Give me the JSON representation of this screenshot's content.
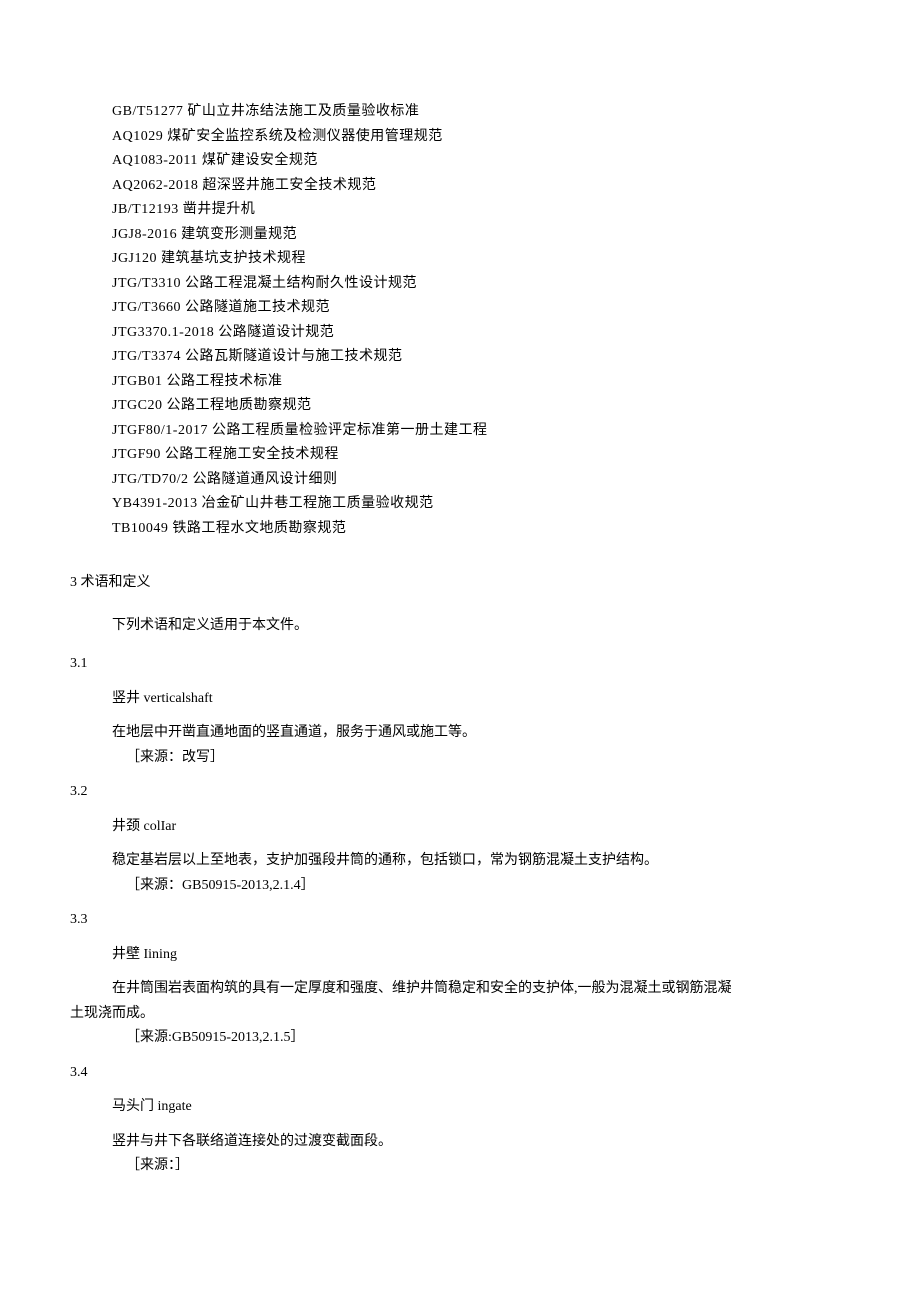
{
  "standards": [
    "GB/T51277 矿山立井冻结法施工及质量验收标准",
    "AQ1029 煤矿安全监控系统及检测仪器使用管理规范",
    "AQ1083-2011 煤矿建设安全规范",
    "AQ2062-2018 超深竖井施工安全技术规范",
    "JB/T12193 凿井提升机",
    "JGJ8-2016 建筑变形测量规范",
    "JGJ120 建筑基坑支护技术规程",
    "JTG/T3310 公路工程混凝土结构耐久性设计规范",
    "JTG/T3660 公路隧道施工技术规范",
    "JTG3370.1-2018 公路隧道设计规范",
    "JTG/T3374 公路瓦斯隧道设计与施工技术规范",
    "JTGB01 公路工程技术标准",
    "JTGC20 公路工程地质勘察规范",
    "JTGF80/1-2017 公路工程质量检验评定标准第一册土建工程",
    "JTGF90 公路工程施工安全技术规程",
    "JTG/TD70/2 公路隧道通风设计细则",
    "YB4391-2013 冶金矿山井巷工程施工质量验收规范",
    "TB10049 铁路工程水文地质勘察规范"
  ],
  "section3": {
    "heading": "3 术语和定义",
    "intro": "下列术语和定义适用于本文件。"
  },
  "t31": {
    "num": "3.1",
    "title": "竖井 verticalshaft",
    "def": "在地层中开凿直通地面的竖直通道，服务于通风或施工等。",
    "src": "［来源：改写］"
  },
  "t32": {
    "num": "3.2",
    "title": "井颈 colIar",
    "def": "稳定基岩层以上至地表，支护加强段井筒的通称，包括锁口，常为钢筋混凝土支护结构。",
    "src": "［来源：GB50915-2013,2.1.4］"
  },
  "t33": {
    "num": "3.3",
    "title": "井壁 Iining",
    "def_indent": "在井筒围岩表面构筑的具有一定厚度和强度、维护井筒稳定和安全的支护体,一般为混凝土或钢筋混凝",
    "def_noindent": "土现浇而成。",
    "src": "［来源:GB50915-2013,2.1.5］"
  },
  "t34": {
    "num": "3.4",
    "title": "马头门 ingate",
    "def": "竖井与井下各联络道连接处的过渡变截面段。",
    "src": "［来源：］"
  }
}
